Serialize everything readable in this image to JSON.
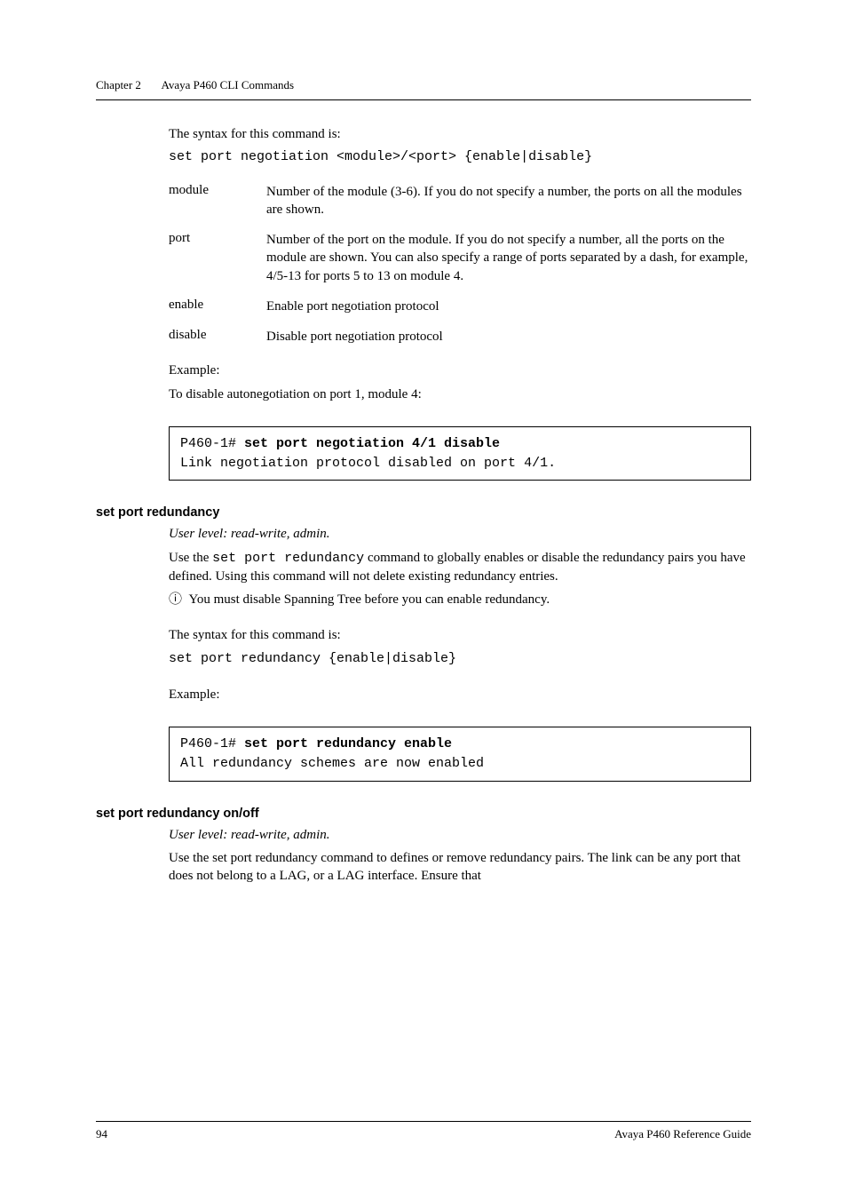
{
  "header": {
    "chapter": "Chapter 2",
    "title": "Avaya P460 CLI Commands"
  },
  "intro": {
    "syntax_lead": "The syntax for this command is:",
    "cmd_bold": "set port negotiation",
    "cmd_args": " <module>/<port> {enable|disable}"
  },
  "params": [
    {
      "name": "module",
      "desc": "Number of the module (3-6). If you do not specify a number, the ports on all the modules are shown."
    },
    {
      "name": "port",
      "desc": "Number of the port on the module. If you do not specify a number, all the ports on the module are shown.\nYou can also specify a range of ports separated by a dash, for example, 4/5-13 for ports 5 to 13 on module 4."
    },
    {
      "name": "enable",
      "desc": "Enable port negotiation protocol"
    },
    {
      "name": "disable",
      "desc": "Disable port negotiation protocol"
    }
  ],
  "example1": {
    "label": "Example:",
    "lead": "To disable autonegotiation on port 1, module 4:",
    "prompt": "P460-1# ",
    "cmd": "set port negotiation 4/1 disable",
    "output": "Link negotiation protocol disabled on port 4/1."
  },
  "sec_redundancy": {
    "heading": "set port redundancy",
    "userlevel": "User level: read-write, admin.",
    "para1a": "Use the ",
    "para1_mono": "set port redundancy",
    "para1b": " command to globally enables or disable the redundancy pairs you have defined. Using this command will not delete existing redundancy entries.",
    "note_icon": "ⓘ",
    "note": "You must disable Spanning Tree before you can enable redundancy.",
    "syntax_lead": "The syntax for this command is:",
    "cmd_bold": "set port redundancy",
    "cmd_args": " {enable|disable}",
    "example_label": "Example:",
    "prompt": "P460-1# ",
    "cmd": "set port redundancy enable",
    "output": "All redundancy schemes are now enabled"
  },
  "sec_onoff": {
    "heading": "set port redundancy on/off",
    "userlevel": "User level: read-write, admin.",
    "para": "Use the set port redundancy command to defines or remove redundancy pairs. The link can be any port that does not belong to a LAG, or a LAG interface.  Ensure that"
  },
  "footer": {
    "page": "94",
    "doc": "Avaya P460 Reference Guide"
  }
}
